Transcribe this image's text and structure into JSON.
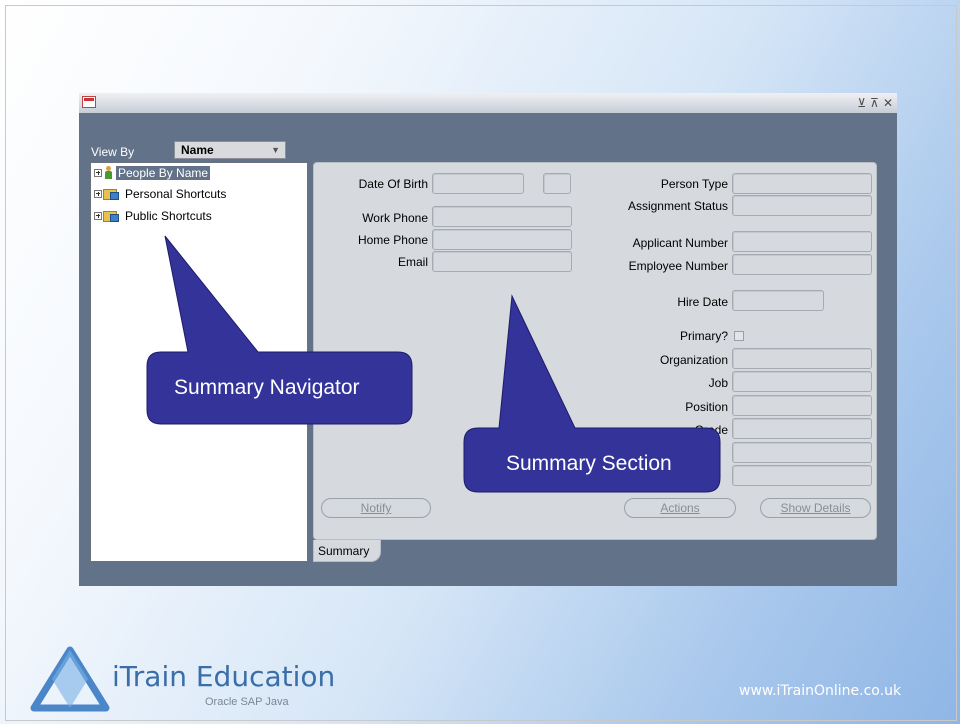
{
  "window": {
    "controls": [
      "⊻",
      "⊼",
      "✕"
    ]
  },
  "view_by": {
    "label": "View By",
    "value": "Name"
  },
  "navigator": {
    "items": [
      {
        "label": "People By Name",
        "selected": true
      },
      {
        "label": "Personal Shortcuts"
      },
      {
        "label": "Public Shortcuts"
      }
    ]
  },
  "summary": {
    "fields": {
      "date_of_birth": "Date Of Birth",
      "work_phone": "Work Phone",
      "home_phone": "Home Phone",
      "email": "Email",
      "person_type": "Person Type",
      "assignment_status": "Assignment Status",
      "applicant_number": "Applicant Number",
      "employee_number": "Employee Number",
      "hire_date": "Hire Date",
      "primary": "Primary?",
      "organization": "Organization",
      "job": "Job",
      "position": "Position",
      "grade_partial": "Grade"
    },
    "buttons": {
      "notify": "Notify",
      "actions": "Actions",
      "show_details": "Show Details"
    },
    "tab": "Summary"
  },
  "callouts": {
    "navigator": "Summary Navigator",
    "section": "Summary Section"
  },
  "branding": {
    "name": "iTrain Education",
    "tagline": "Oracle SAP Java",
    "url": "www.iTrainOnline.co.uk"
  },
  "colors": {
    "window_bg": "#627289",
    "panel_bg": "#d6d9de",
    "callout_bg": "#33339a",
    "brand_blue": "#3a6ea8"
  }
}
